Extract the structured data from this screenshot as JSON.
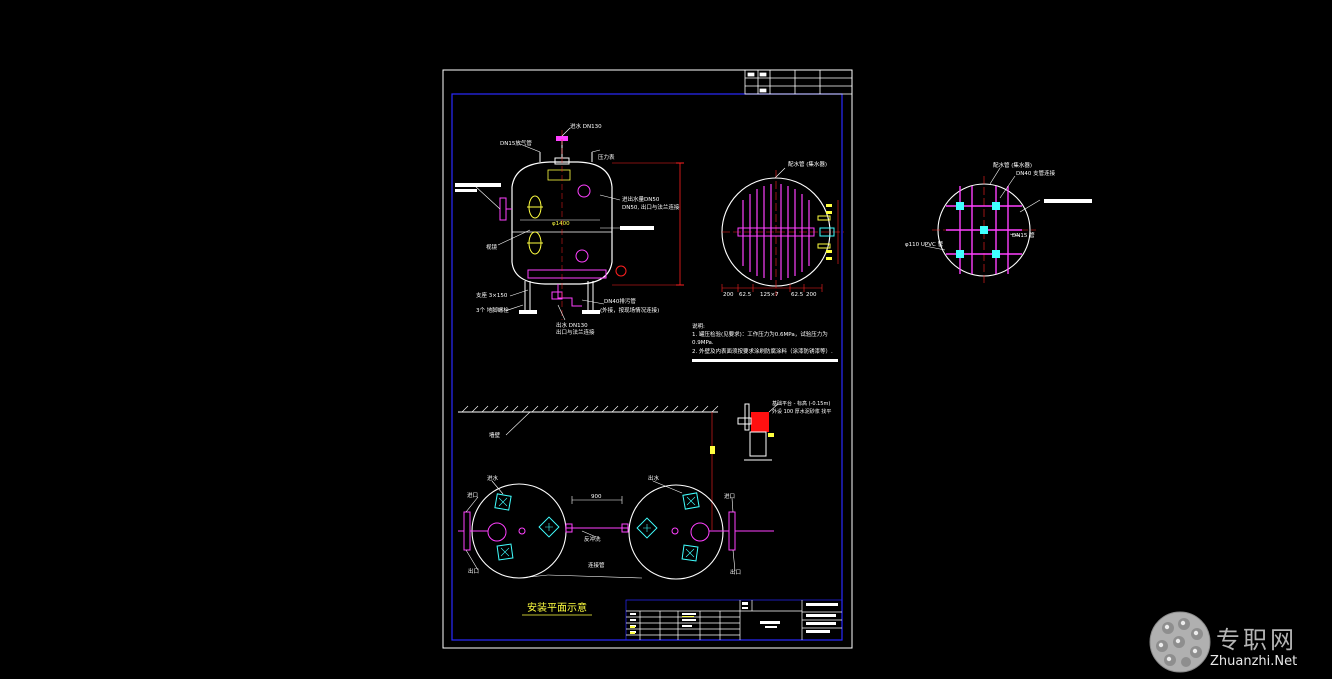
{
  "drawing": {
    "title": "安装平面示意",
    "notes_heading": "说明:",
    "notes": [
      "1. 罐压检验(见要求)：工作压力为0.6MPa，试验压力为",
      "   0.9MPa.",
      "2. 外壁及内表面须按要求涂刷防腐涂料（涂漆防锈漆等）."
    ],
    "callouts": {
      "manhole_top": "进水 DN130",
      "vent_pipe": "DN15放气管",
      "pressure_gauge": "压力表",
      "inlet_label": "进水",
      "shell_label": "进出水量DN50",
      "outlet_spec": "DN50, 出口与法兰连接",
      "sight_glass": "视镜",
      "diameter": "φ1400",
      "support": "支座 3×150",
      "anchor": "3个 地脚螺栓",
      "drain": "DN40排污管",
      "drain_note": "(外接，按现场情况连接)",
      "outlet_bottom": "出水 DN130",
      "outlet_flange": "出口与法兰连接",
      "distributor_a": "配水管 (集水器)",
      "distributor_b": "配水管 (集水器)",
      "branch_pipe": "DN40 支管连接",
      "slot_pipe": "DN15 管",
      "main_pipe": "φ110 UPVC 管",
      "wall_label": "墙壁",
      "water_in": "进水",
      "water_out": "出水",
      "inlet_a": "进口",
      "inlet_b": "进口",
      "outlet_a": "出口",
      "outlet_b": "出口",
      "spacing": "900",
      "backwash": "反冲洗",
      "connector": "连接管",
      "base_note_1": "基础平台 - 标高 (-0.15m)",
      "base_note_2": "外设 100 厚水泥砂浆 找平",
      "dim_a": "200",
      "dim_b": "62.5",
      "dim_c": "125×7",
      "dim_d": "62.5",
      "dim_e": "200"
    }
  },
  "watermark": {
    "cn": "专职网",
    "en": "Zhuanzhi.Net"
  },
  "colors": {
    "frame": "#ffffff",
    "border": "#1a1aff",
    "vessel": "#ffffff",
    "dimension": "#ff2020",
    "piping": "#ff40ff",
    "text": "#ffff40",
    "nozzle": "#40ffff",
    "callout": "#ffffff"
  }
}
